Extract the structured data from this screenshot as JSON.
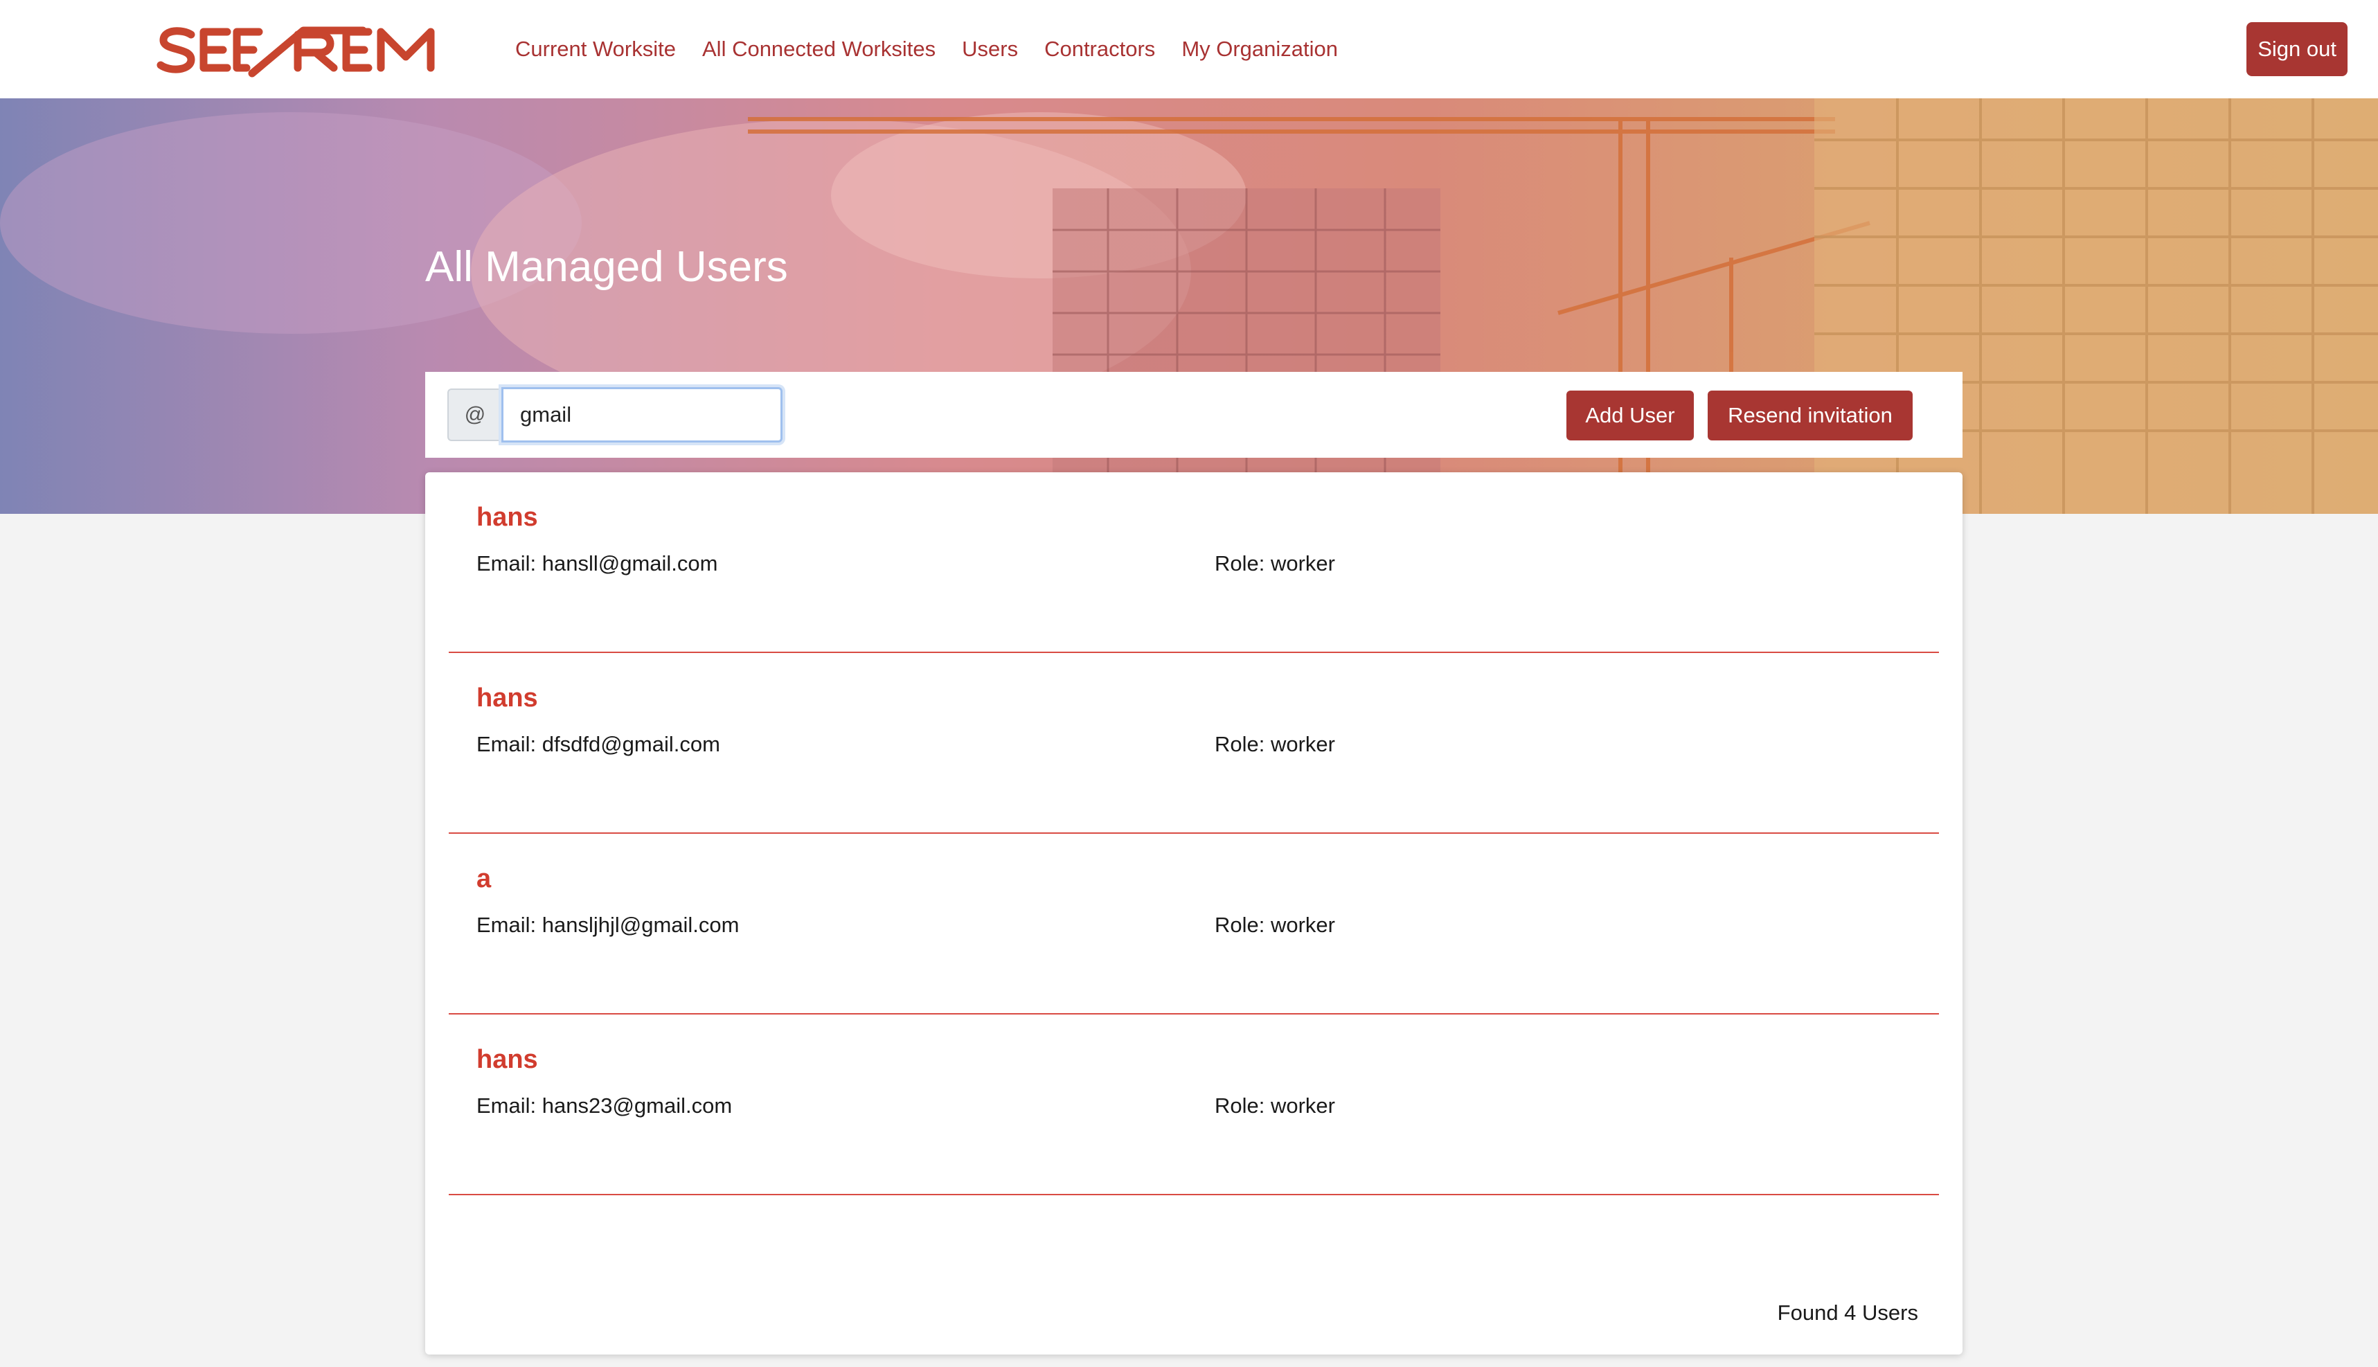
{
  "brand": {
    "logo_text": "SEE REM",
    "accent": "#a83632",
    "name_color": "#d13c2e"
  },
  "nav": {
    "items": [
      {
        "label": "Current Worksite"
      },
      {
        "label": "All Connected Worksites"
      },
      {
        "label": "Users"
      },
      {
        "label": "Contractors"
      },
      {
        "label": "My Organization"
      }
    ],
    "sign_out": "Sign out"
  },
  "hero": {
    "title": "All Managed Users"
  },
  "toolbar": {
    "prefix": "@",
    "search_value": "gmail",
    "add_user": "Add User",
    "resend_invitation": "Resend invitation"
  },
  "users": [
    {
      "name": "hans",
      "email": "Email: hansll@gmail.com",
      "role": "Role: worker"
    },
    {
      "name": "hans",
      "email": "Email: dfsdfd@gmail.com",
      "role": "Role: worker"
    },
    {
      "name": "a",
      "email": "Email: hansljhjl@gmail.com",
      "role": "Role: worker"
    },
    {
      "name": "hans",
      "email": "Email: hans23@gmail.com",
      "role": "Role: worker"
    }
  ],
  "summary": "Found 4 Users"
}
